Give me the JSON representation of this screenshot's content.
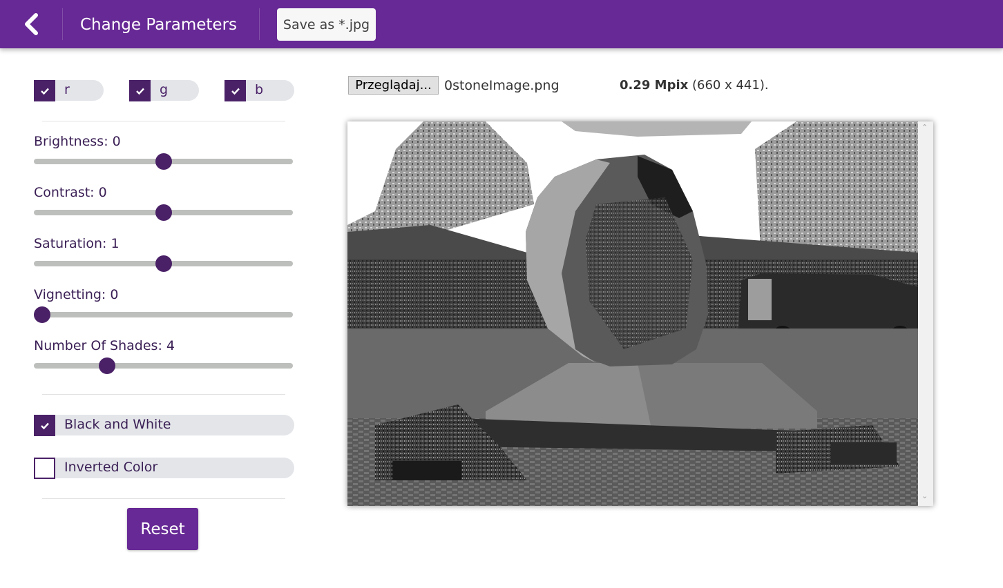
{
  "header": {
    "title": "Change Parameters",
    "save_label": "Save as *.jpg",
    "accent_color": "#672995"
  },
  "channels": [
    {
      "label": "r",
      "checked": true
    },
    {
      "label": "g",
      "checked": true
    },
    {
      "label": "b",
      "checked": true
    }
  ],
  "sliders": [
    {
      "label": "Brightness: 0",
      "name": "Brightness",
      "value": 0,
      "fraction": 0.5
    },
    {
      "label": "Contrast: 0",
      "name": "Contrast",
      "value": 0,
      "fraction": 0.5
    },
    {
      "label": "Saturation: 1",
      "name": "Saturation",
      "value": 1,
      "fraction": 0.5
    },
    {
      "label": "Vignetting: 0",
      "name": "Vignetting",
      "value": 0,
      "fraction": 0.0
    },
    {
      "label": "Number Of Shades: 4",
      "name": "Number Of Shades",
      "value": 4,
      "fraction": 0.267
    }
  ],
  "toggles": [
    {
      "label": "Black and White",
      "checked": true
    },
    {
      "label": "Inverted Color",
      "checked": false
    }
  ],
  "reset_label": "Reset",
  "file": {
    "button_label": "Przeglądaj...",
    "name": "0stoneImage.png",
    "mpix": "0.29 Mpix",
    "dimensions": "(660 x 441)."
  }
}
